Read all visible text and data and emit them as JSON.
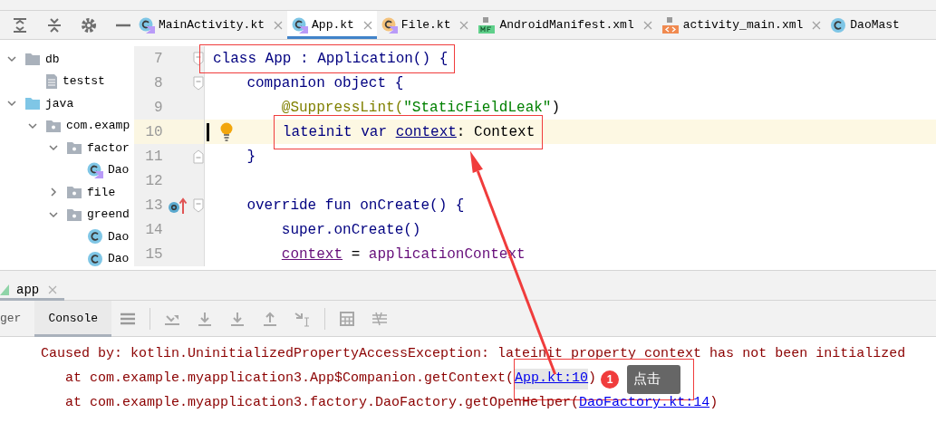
{
  "tabs": [
    {
      "label": "MainActivity.kt",
      "kind": "kotlin-class",
      "selected": false,
      "closable": true
    },
    {
      "label": "App.kt",
      "kind": "kotlin-class",
      "selected": true,
      "closable": true
    },
    {
      "label": "File.kt",
      "kind": "kotlin-file",
      "selected": false,
      "closable": true
    },
    {
      "label": "AndroidManifest.xml",
      "kind": "manifest",
      "selected": false,
      "closable": true
    },
    {
      "label": "activity_main.xml",
      "kind": "layout",
      "selected": false,
      "closable": true
    },
    {
      "label": "DaoMast",
      "kind": "class",
      "selected": false,
      "closable": false
    }
  ],
  "project_tree": [
    {
      "children": [
        {
          "label": "db",
          "kind": "folder",
          "expanded": true,
          "children": [
            {
              "label": "testst",
              "kind": "text-file"
            }
          ]
        }
      ]
    },
    {
      "label": "java",
      "kind": "source-folder",
      "expanded": true,
      "children": [
        {
          "label": "com.examp",
          "kind": "package",
          "expanded": true,
          "children": [
            {
              "label": "factor",
              "kind": "package",
              "expanded": true,
              "children": [
                {
                  "label": "Dao",
                  "kind": "kotlin-class"
                }
              ]
            },
            {
              "label": "file",
              "kind": "package",
              "expanded": false
            },
            {
              "label": "greend",
              "kind": "package",
              "expanded": true,
              "children": [
                {
                  "label": "Dao",
                  "kind": "class"
                },
                {
                  "label": "Dao",
                  "kind": "class"
                }
              ]
            }
          ]
        }
      ]
    }
  ],
  "editor": {
    "lines": [
      {
        "number": "7",
        "current": false,
        "boxed": true,
        "tokens": [
          {
            "text": "class App : Application() {",
            "kind": "keyword"
          }
        ]
      },
      {
        "number": "8",
        "current": false,
        "tokens": [
          {
            "text": "    companion object {",
            "kind": "keyword"
          }
        ]
      },
      {
        "number": "9",
        "current": false,
        "tokens": [
          {
            "text": "        @SuppressLint(",
            "kind": "annotation"
          },
          {
            "text": "\"StaticFieldLeak\"",
            "kind": "string"
          },
          {
            "text": ")",
            "kind": "plain"
          }
        ]
      },
      {
        "number": "10",
        "current": true,
        "intention": true,
        "boxed": true,
        "tokens": [
          {
            "text": "        lateinit var ",
            "kind": "keyword"
          },
          {
            "text": "context",
            "kind": "declaration"
          },
          {
            "text": ": Context",
            "kind": "plain"
          }
        ]
      },
      {
        "number": "11",
        "current": false,
        "tokens": [
          {
            "text": "    }",
            "kind": "keyword"
          }
        ]
      },
      {
        "number": "12",
        "current": false
      },
      {
        "number": "13",
        "current": false,
        "overrides": true,
        "tokens": [
          {
            "text": "    override fun onCreate() {",
            "kind": "keyword"
          }
        ]
      },
      {
        "number": "14",
        "current": false,
        "tokens": [
          {
            "text": "        super.onCreate()",
            "kind": "keyword"
          }
        ]
      },
      {
        "number": "15",
        "current": false,
        "tokens": [
          {
            "text": "        context",
            "kind": "property"
          },
          {
            "text": " = ",
            "kind": "plain"
          },
          {
            "text": "applicationContext",
            "kind": "call"
          }
        ]
      }
    ]
  },
  "run_tabs": [
    {
      "label": "app",
      "selected": true,
      "closable": true
    }
  ],
  "console_tabs": [
    {
      "label": "ger",
      "selected": false
    },
    {
      "label": "Console",
      "selected": true
    }
  ],
  "console": [
    {
      "text": "Caused by: kotlin.UninitializedPropertyAccessException: lateinit property context has not been initialized"
    },
    {
      "text": "   at com.example.myapplication3.App$Companion.getContext(",
      "link": "App.kt:10",
      "link_highlighted": true,
      "suffix": ")",
      "callout": true
    },
    {
      "text": "   at com.example.myapplication3.factory.DaoFactory.getOpenHelper(",
      "link": "DaoFactory.kt:14",
      "link_highlighted": false,
      "suffix": ")"
    }
  ],
  "annotation": {
    "badge": "1",
    "tooltip": "点击"
  }
}
